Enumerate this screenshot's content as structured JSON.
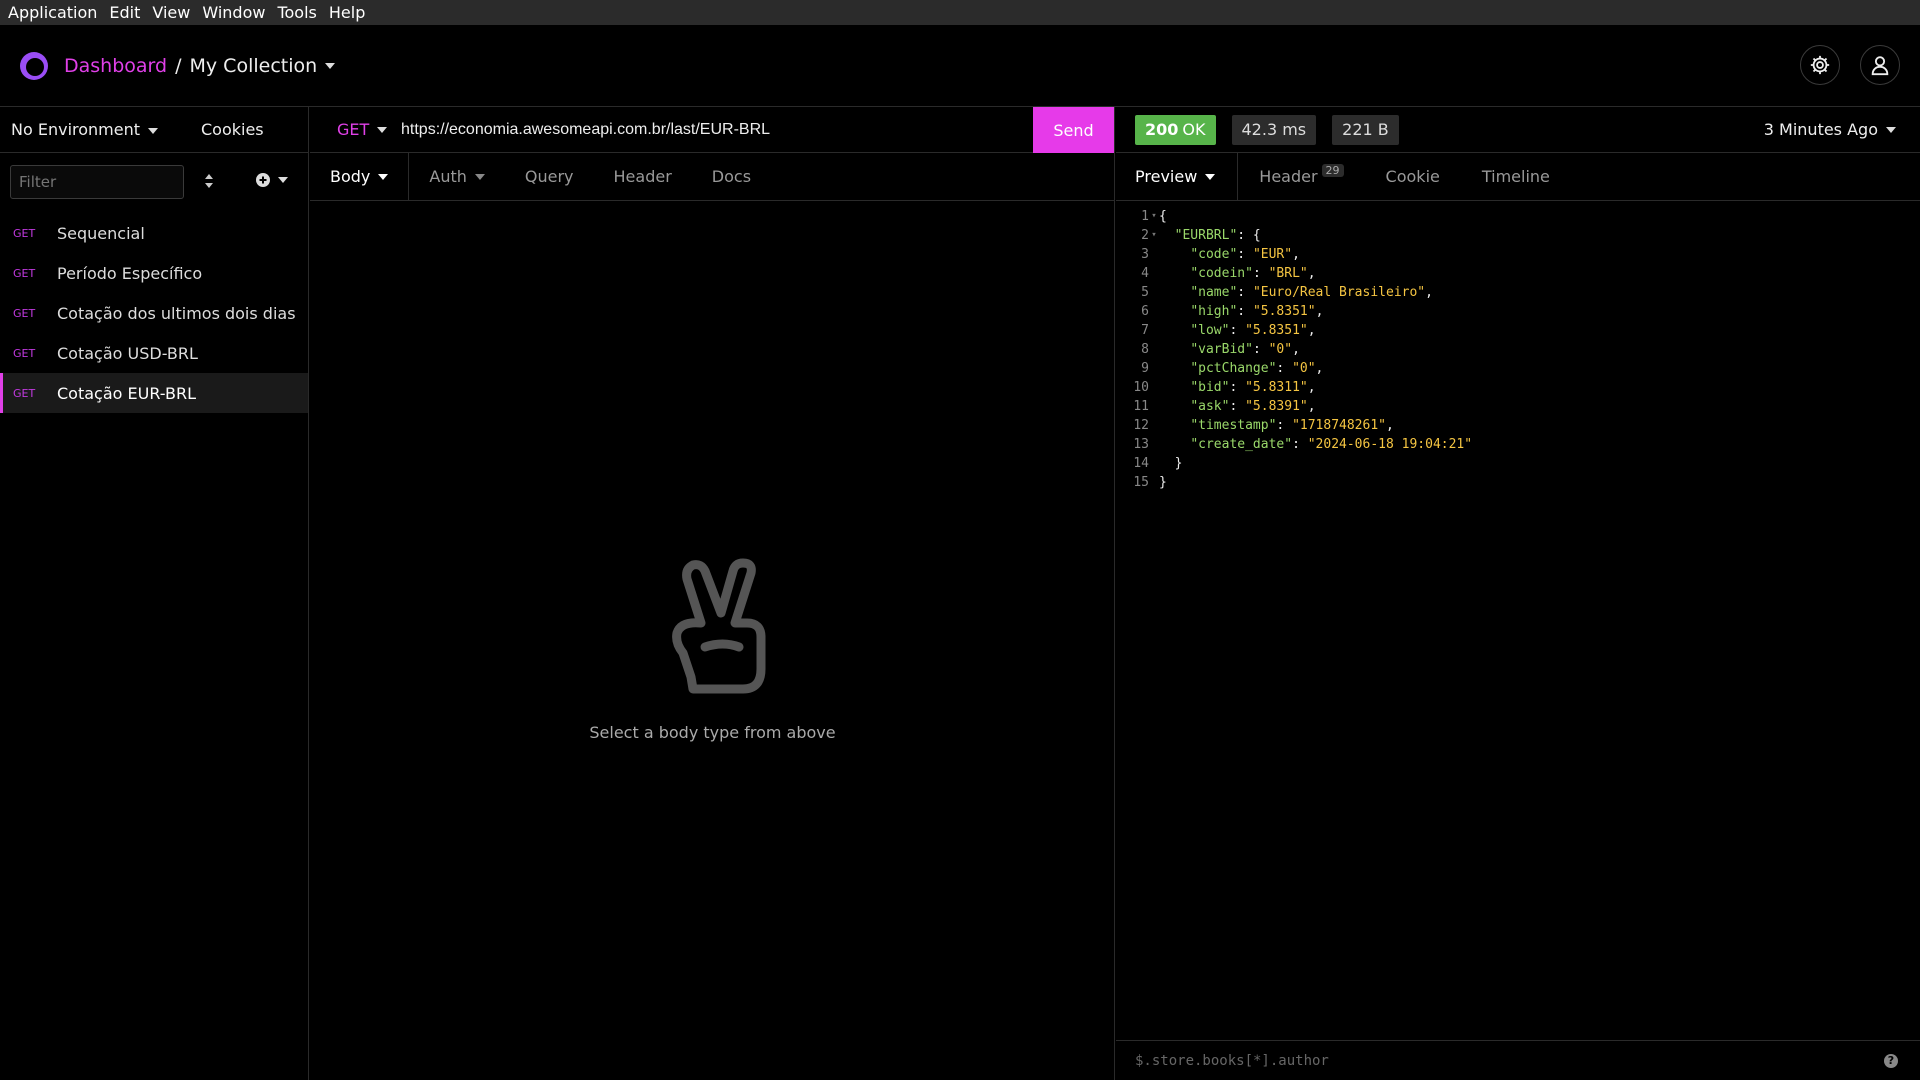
{
  "menu": [
    "Application",
    "Edit",
    "Window",
    "Tools",
    "Help"
  ],
  "menu_items": {
    "application": "Application",
    "edit": "Edit",
    "view": "View",
    "window": "Window",
    "tools": "Tools",
    "help": "Help"
  },
  "breadcrumb": {
    "dashboard": "Dashboard",
    "separator": "/",
    "collection": "My Collection"
  },
  "sidebar": {
    "environment": "No Environment",
    "cookies": "Cookies",
    "filter_placeholder": "Filter",
    "requests": [
      {
        "method": "GET",
        "name": "Sequencial"
      },
      {
        "method": "GET",
        "name": "Período Específico"
      },
      {
        "method": "GET",
        "name": "Cotação dos ultimos dois dias"
      },
      {
        "method": "GET",
        "name": "Cotação USD-BRL"
      },
      {
        "method": "GET",
        "name": "Cotação EUR-BRL"
      }
    ]
  },
  "request": {
    "method": "GET",
    "url": "https://economia.awesomeapi.com.br/last/EUR-BRL",
    "send_label": "Send",
    "tabs": {
      "body": "Body",
      "auth": "Auth",
      "query": "Query",
      "header": "Header",
      "docs": "Docs"
    },
    "empty_message": "Select a body type from above"
  },
  "response": {
    "status_code": "200",
    "status_text": "OK",
    "time": "42.3 ms",
    "size": "221 B",
    "age": "3 Minutes Ago",
    "tabs": {
      "preview": "Preview",
      "header": "Header",
      "header_count": "29",
      "cookie": "Cookie",
      "timeline": "Timeline"
    },
    "body_lines": [
      {
        "n": "1",
        "fold": "▾",
        "indent": "",
        "key": "",
        "val": "",
        "text": "{"
      },
      {
        "n": "2",
        "fold": "▾",
        "indent": "  ",
        "key": "\"EURBRL\"",
        "val": "",
        "text": ": {"
      },
      {
        "n": "3",
        "fold": "",
        "indent": "    ",
        "key": "\"code\"",
        "val": "\"EUR\"",
        "text": ","
      },
      {
        "n": "4",
        "fold": "",
        "indent": "    ",
        "key": "\"codein\"",
        "val": "\"BRL\"",
        "text": ","
      },
      {
        "n": "5",
        "fold": "",
        "indent": "    ",
        "key": "\"name\"",
        "val": "\"Euro/Real Brasileiro\"",
        "text": ","
      },
      {
        "n": "6",
        "fold": "",
        "indent": "    ",
        "key": "\"high\"",
        "val": "\"5.8351\"",
        "text": ","
      },
      {
        "n": "7",
        "fold": "",
        "indent": "    ",
        "key": "\"low\"",
        "val": "\"5.8351\"",
        "text": ","
      },
      {
        "n": "8",
        "fold": "",
        "indent": "    ",
        "key": "\"varBid\"",
        "val": "\"0\"",
        "text": ","
      },
      {
        "n": "9",
        "fold": "",
        "indent": "    ",
        "key": "\"pctChange\"",
        "val": "\"0\"",
        "text": ","
      },
      {
        "n": "10",
        "fold": "",
        "indent": "    ",
        "key": "\"bid\"",
        "val": "\"5.8311\"",
        "text": ","
      },
      {
        "n": "11",
        "fold": "",
        "indent": "    ",
        "key": "\"ask\"",
        "val": "\"5.8391\"",
        "text": ","
      },
      {
        "n": "12",
        "fold": "",
        "indent": "    ",
        "key": "\"timestamp\"",
        "val": "\"1718748261\"",
        "text": ","
      },
      {
        "n": "13",
        "fold": "",
        "indent": "    ",
        "key": "\"create_date\"",
        "val": "\"2024-06-18 19:04:21\"",
        "text": ""
      },
      {
        "n": "14",
        "fold": "",
        "indent": "  ",
        "key": "",
        "val": "",
        "text": "}"
      },
      {
        "n": "15",
        "fold": "",
        "indent": "",
        "key": "",
        "val": "",
        "text": "}"
      }
    ],
    "filter_placeholder": "$.store.books[*].author"
  },
  "icons": {
    "settings": "gear-icon",
    "account": "user-icon",
    "sort": "sort-icon",
    "add": "plus-circle-icon",
    "empty": "peace-hand-icon",
    "help": "help-icon"
  },
  "colors": {
    "accent": "#e040e8",
    "send": "#e63ae9",
    "ok": "#57b44a",
    "json_key": "#9ad86a",
    "json_string": "#f5c542"
  }
}
